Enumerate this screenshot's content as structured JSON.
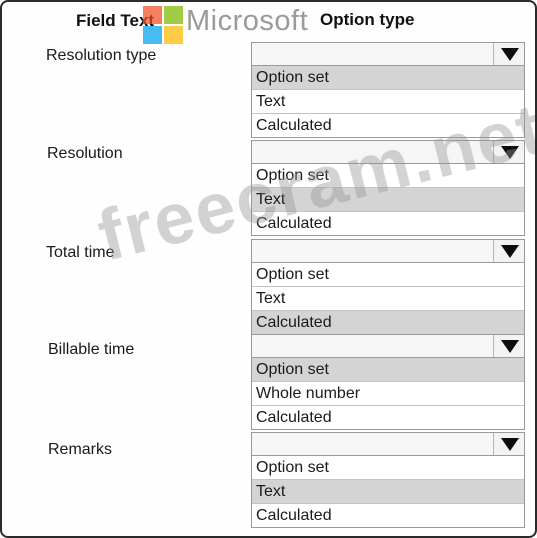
{
  "headers": {
    "field_text": "Field Text",
    "option_type": "Option type"
  },
  "logo": {
    "wordmark": "Microsoft",
    "colors": [
      "#f25022",
      "#7fba00",
      "#00a4ef",
      "#ffb900"
    ]
  },
  "watermark": "freecram.net",
  "rows": [
    {
      "label": "Resolution type",
      "dropdown_value": "",
      "options": [
        "Option set",
        "Text",
        "Calculated"
      ],
      "selected_index": 0
    },
    {
      "label": "Resolution",
      "dropdown_value": "",
      "options": [
        "Option set",
        "Text",
        "Calculated"
      ],
      "selected_index": 1
    },
    {
      "label": "Total time",
      "dropdown_value": "",
      "options": [
        "Option set",
        "Text",
        "Calculated"
      ],
      "selected_index": 2
    },
    {
      "label": "Billable time",
      "dropdown_value": "",
      "options": [
        "Option set",
        "Whole number",
        "Calculated"
      ],
      "selected_index": 0
    },
    {
      "label": "Remarks",
      "dropdown_value": "",
      "options": [
        "Option set",
        "Text",
        "Calculated"
      ],
      "selected_index": 1
    }
  ],
  "colors": {
    "selected_option": "#d4d4d4",
    "border": "#9a9a9a"
  }
}
